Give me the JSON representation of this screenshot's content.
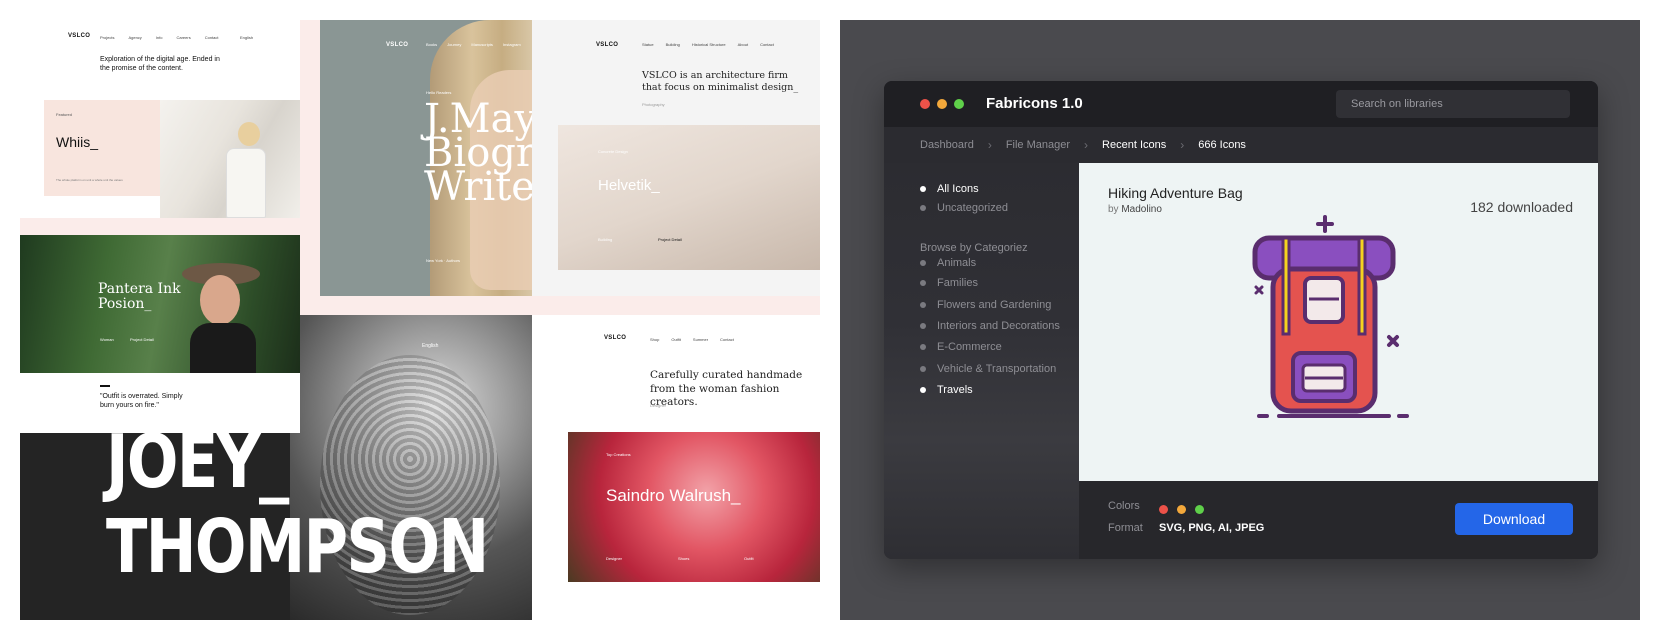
{
  "collage": {
    "cardA": {
      "logo": "VSLCO",
      "nav": [
        "Projects",
        "Agency",
        "Info",
        "Careers",
        "Contact"
      ],
      "lang": "English",
      "headline": "Exploration of the digital age. Ended in the promise of the content.",
      "label": "Featured",
      "title": "Whiis_",
      "caption": "The whole platform on unit a whole unit the values"
    },
    "cardB": {
      "logo": "VSLCO",
      "nav": [
        "Books",
        "Journey",
        "Manuscripts",
        "Instagram"
      ],
      "kicker": "Hello Readers",
      "headline_lines": [
        "J.May",
        "Biogr",
        "Write"
      ],
      "footer": "New York · Authors"
    },
    "cardC": {
      "logo": "VSLCO",
      "nav": [
        "Statue",
        "Building",
        "Historical Structure",
        "About",
        "Contact"
      ],
      "headline": "VSLCO is an architecture firm that focus on minimalist design_",
      "sub": "Photography",
      "kicker": "Concrete Design",
      "title": "Helvetik_",
      "meta": "Building",
      "link": "Project Detail"
    },
    "cardD": {
      "title_lines": [
        "Pantera Ink",
        "Posion_"
      ],
      "meta": "Woman",
      "link": "Project Detail",
      "quote": "\"Outfit is overrated. Simply burn yours on fire.\""
    },
    "cardE": {
      "lang": "English",
      "line1": "JOEY_",
      "line2": "THOMPSON"
    },
    "cardF": {
      "logo": "VSLCO",
      "nav": [
        "Shop",
        "Outfit",
        "Summer",
        "Contact"
      ],
      "headline": "Carefully curated handmade from the woman fashion creators.",
      "sub": "Designer",
      "kicker": "Top Creations",
      "title": "Saindro Walrush_",
      "meta_left": "Designer",
      "meta_mid": "Shoes",
      "meta_right": "Outfit"
    }
  },
  "app": {
    "title": "Fabricons 1.0",
    "traffic_colors": [
      "#ed5249",
      "#f3a83b",
      "#5fd04a"
    ],
    "search": {
      "placeholder": "Search on libraries",
      "value": ""
    },
    "breadcrumb": [
      "Dashboard",
      "File Manager",
      "Recent Icons",
      "666 Icons"
    ],
    "sidebar": {
      "top_items": [
        {
          "label": "All Icons",
          "active": true
        },
        {
          "label": "Uncategorized",
          "active": false
        }
      ],
      "heading": "Browse by Categoriez",
      "categories": [
        {
          "label": "Animals",
          "active": false
        },
        {
          "label": "Families",
          "active": false
        },
        {
          "label": "Flowers and Gardening",
          "active": false
        },
        {
          "label": "Interiors and Decorations",
          "active": false
        },
        {
          "label": "E-Commerce",
          "active": false
        },
        {
          "label": "Vehicle & Transportation",
          "active": false
        },
        {
          "label": "Travels",
          "active": true
        }
      ]
    },
    "preview": {
      "name": "Hiking Adventure Bag",
      "by_prefix": "by",
      "author": "Madolino",
      "downloads": "182 downloaded",
      "icon": "hiking-backpack-icon"
    },
    "footer": {
      "colors_label": "Colors",
      "colors": [
        "#ed5249",
        "#f3a83b",
        "#5fd04a"
      ],
      "format_label": "Format",
      "format_value": "SVG, PNG, AI, JPEG",
      "download_label": "Download"
    },
    "accent": "#2466e8"
  }
}
